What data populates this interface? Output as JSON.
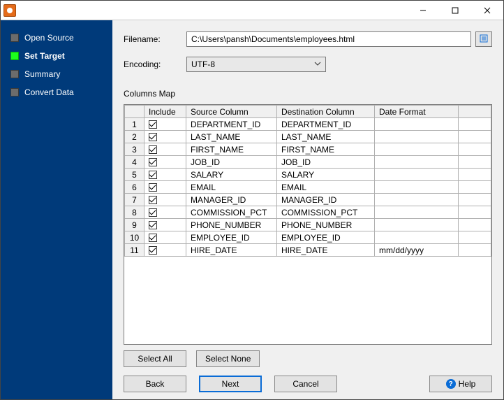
{
  "title": "",
  "sidebar": {
    "items": [
      {
        "label": "Open Source",
        "active": false
      },
      {
        "label": "Set Target",
        "active": true
      },
      {
        "label": "Summary",
        "active": false
      },
      {
        "label": "Convert Data",
        "active": false
      }
    ]
  },
  "form": {
    "filename_label": "Filename:",
    "filename_value": "C:\\Users\\pansh\\Documents\\employees.html",
    "encoding_label": "Encoding:",
    "encoding_value": "UTF-8"
  },
  "section": {
    "columns_map_label": "Columns Map"
  },
  "table": {
    "headers": {
      "include": "Include",
      "source": "Source Column",
      "dest": "Destination Column",
      "fmt": "Date Format"
    },
    "rows": [
      {
        "n": "1",
        "include": true,
        "src": "DEPARTMENT_ID",
        "dst": "DEPARTMENT_ID",
        "fmt": ""
      },
      {
        "n": "2",
        "include": true,
        "src": "LAST_NAME",
        "dst": "LAST_NAME",
        "fmt": ""
      },
      {
        "n": "3",
        "include": true,
        "src": "FIRST_NAME",
        "dst": "FIRST_NAME",
        "fmt": ""
      },
      {
        "n": "4",
        "include": true,
        "src": "JOB_ID",
        "dst": "JOB_ID",
        "fmt": ""
      },
      {
        "n": "5",
        "include": true,
        "src": "SALARY",
        "dst": "SALARY",
        "fmt": ""
      },
      {
        "n": "6",
        "include": true,
        "src": "EMAIL",
        "dst": "EMAIL",
        "fmt": ""
      },
      {
        "n": "7",
        "include": true,
        "src": "MANAGER_ID",
        "dst": "MANAGER_ID",
        "fmt": ""
      },
      {
        "n": "8",
        "include": true,
        "src": "COMMISSION_PCT",
        "dst": "COMMISSION_PCT",
        "fmt": ""
      },
      {
        "n": "9",
        "include": true,
        "src": "PHONE_NUMBER",
        "dst": "PHONE_NUMBER",
        "fmt": ""
      },
      {
        "n": "10",
        "include": true,
        "src": "EMPLOYEE_ID",
        "dst": "EMPLOYEE_ID",
        "fmt": ""
      },
      {
        "n": "11",
        "include": true,
        "src": "HIRE_DATE",
        "dst": "HIRE_DATE",
        "fmt": "mm/dd/yyyy"
      }
    ]
  },
  "buttons": {
    "select_all": "Select All",
    "select_none": "Select None",
    "back": "Back",
    "next": "Next",
    "cancel": "Cancel",
    "help": "Help"
  }
}
